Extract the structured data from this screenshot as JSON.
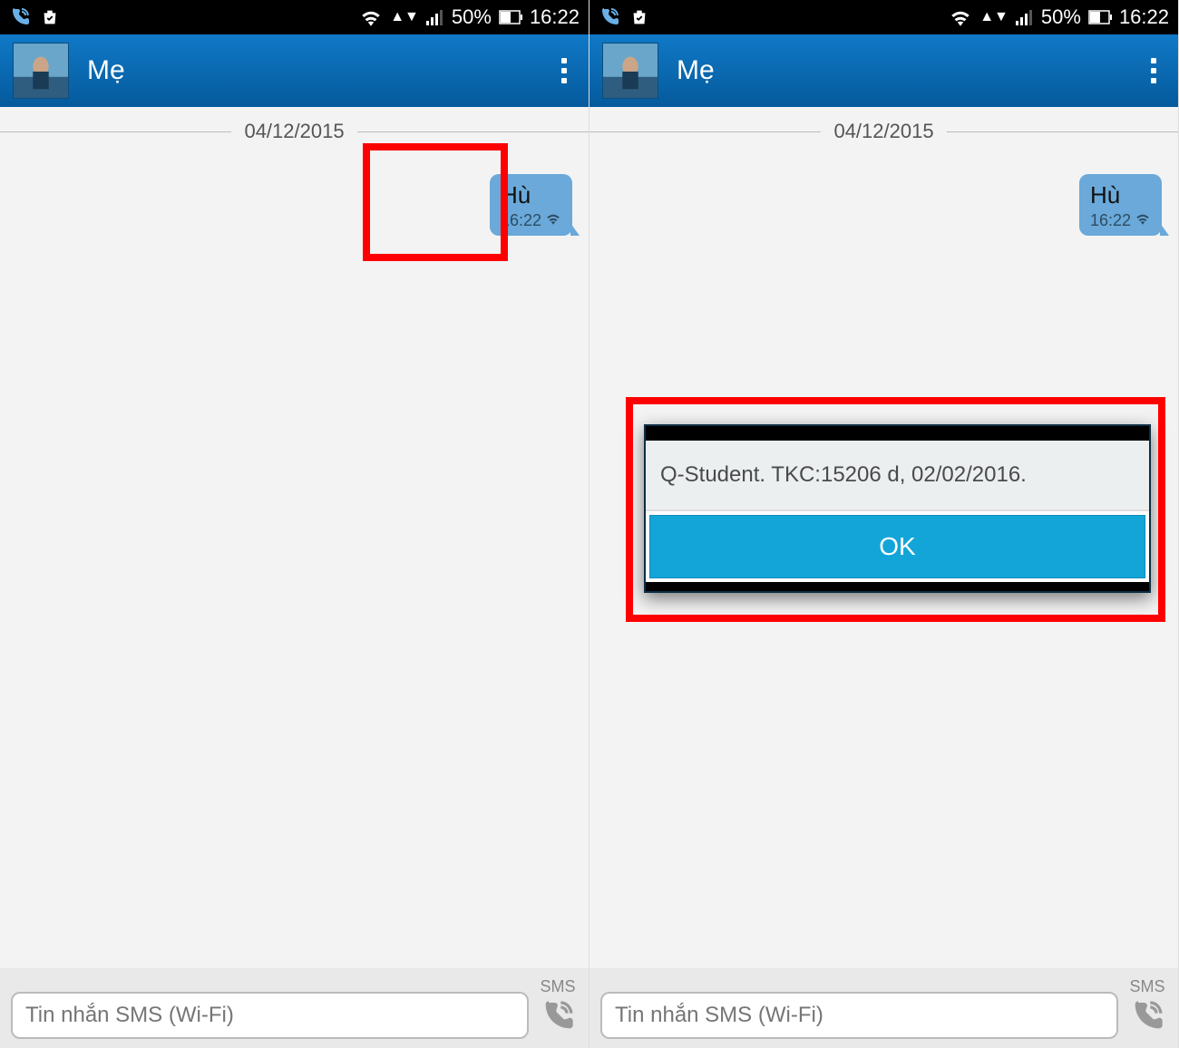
{
  "left": {
    "status": {
      "battery": "50%",
      "time": "16:22"
    },
    "header": {
      "contact": "Mẹ"
    },
    "date": "04/12/2015",
    "message": {
      "text": "Hù",
      "time": "16:22"
    },
    "input": {
      "placeholder": "Tin nhắn SMS (Wi-Fi)",
      "sendLabel": "SMS"
    }
  },
  "right": {
    "status": {
      "battery": "50%",
      "time": "16:22"
    },
    "header": {
      "contact": "Mẹ"
    },
    "date": "04/12/2015",
    "message": {
      "text": "Hù",
      "time": "16:22"
    },
    "dialog": {
      "body": "Q-Student. TKC:15206 d, 02/02/2016.",
      "ok": "OK"
    },
    "input": {
      "placeholder": "Tin nhắn SMS (Wi-Fi)",
      "sendLabel": "SMS"
    }
  }
}
